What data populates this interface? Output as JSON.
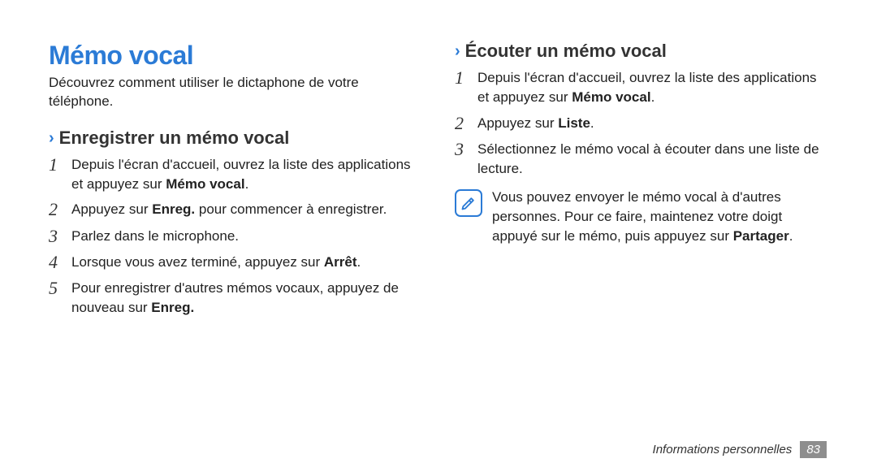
{
  "left": {
    "title": "Mémo vocal",
    "intro": "Découvrez comment utiliser le dictaphone de votre téléphone.",
    "sub": "Enregistrer un mémo vocal",
    "steps": [
      {
        "n": "1",
        "html": "Depuis l'écran d'accueil, ouvrez la liste des applications et appuyez sur <b>Mémo vocal</b>."
      },
      {
        "n": "2",
        "html": "Appuyez sur <b>Enreg.</b> pour commencer à enregistrer."
      },
      {
        "n": "3",
        "html": "Parlez dans le microphone."
      },
      {
        "n": "4",
        "html": "Lorsque vous avez terminé, appuyez sur <b>Arrêt</b>."
      },
      {
        "n": "5",
        "html": "Pour enregistrer d'autres mémos vocaux, appuyez de nouveau sur <b>Enreg.</b>"
      }
    ]
  },
  "right": {
    "sub": "Écouter un mémo vocal",
    "steps": [
      {
        "n": "1",
        "html": "Depuis l'écran d'accueil, ouvrez la liste des applications et appuyez sur <b>Mémo vocal</b>."
      },
      {
        "n": "2",
        "html": "Appuyez sur <b>Liste</b>."
      },
      {
        "n": "3",
        "html": "Sélectionnez le mémo vocal à écouter dans une liste de lecture."
      }
    ],
    "note_html": "Vous pouvez envoyer le mémo vocal à d'autres personnes. Pour ce faire, maintenez votre doigt appuyé sur le mémo, puis appuyez sur <b>Partager</b>."
  },
  "footer": {
    "label": "Informations personnelles",
    "page": "83"
  },
  "chevron": "›"
}
